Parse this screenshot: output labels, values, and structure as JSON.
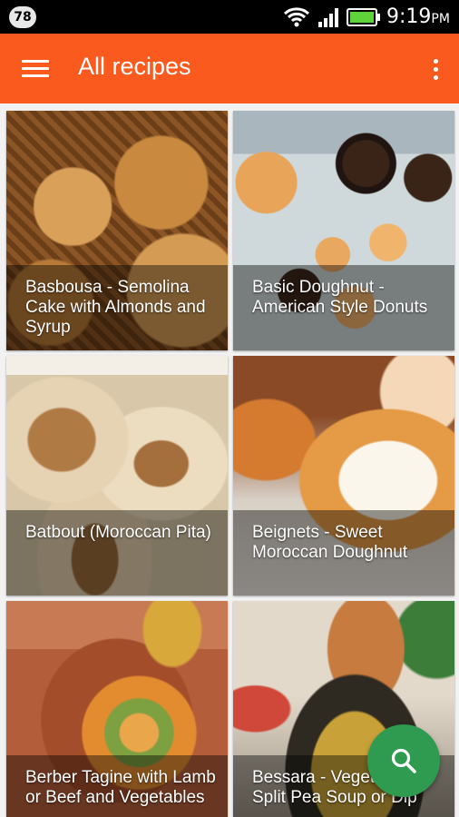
{
  "status_bar": {
    "notification_count": "78",
    "time": "9:19",
    "ampm": "PM",
    "icons": [
      "wifi-icon",
      "signal-icon",
      "battery-icon"
    ]
  },
  "app_bar": {
    "title": "All recipes",
    "background_color": "#fa5a1e",
    "menu_icon": "menu-icon",
    "overflow_icon": "more-vert-icon"
  },
  "recipes": [
    {
      "title": "Basbousa - Semolina Cake with Almonds and Syrup"
    },
    {
      "title": "Basic Doughnut - American Style Donuts"
    },
    {
      "title": "Batbout (Moroccan Pita)"
    },
    {
      "title": "Beignets - Sweet Moroccan Doughnut"
    },
    {
      "title": "Berber Tagine with Lamb or Beef and Vegetables"
    },
    {
      "title": "Bessara - Vegetarian Split Pea Soup or Dip"
    }
  ],
  "fab": {
    "icon": "search-icon",
    "color": "#2e9b50"
  }
}
